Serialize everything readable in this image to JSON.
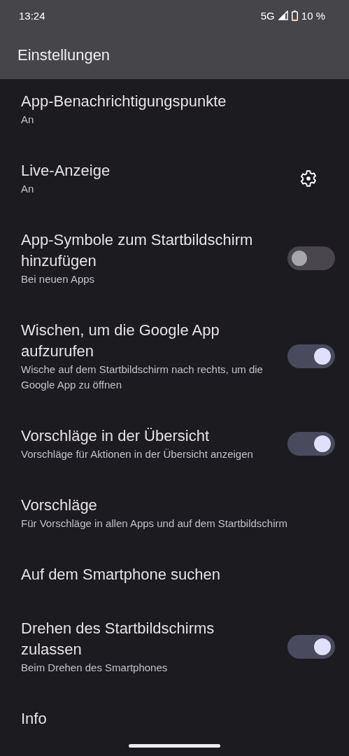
{
  "status_bar": {
    "time": "13:24",
    "network": "5G",
    "battery": "10 %"
  },
  "app_bar": {
    "title": "Einstellungen"
  },
  "settings": [
    {
      "kind": "plain",
      "title": "App-Benachrichtigungspunkte",
      "subtitle": "An"
    },
    {
      "kind": "gear",
      "title": "Live-Anzeige",
      "subtitle": "An"
    },
    {
      "kind": "toggle",
      "title": "App-Symbole zum Startbildschirm hinzufügen",
      "subtitle": "Bei neuen Apps",
      "on": false
    },
    {
      "kind": "toggle",
      "title": "Wischen, um die Google App aufzurufen",
      "subtitle": "Wische auf dem Startbildschirm nach rechts, um die Google App zu öffnen",
      "on": true
    },
    {
      "kind": "toggle",
      "title": "Vorschläge in der Übersicht",
      "subtitle": "Vorschläge für Aktionen in der Übersicht anzeigen",
      "on": true
    },
    {
      "kind": "plain",
      "title": "Vorschläge",
      "subtitle": "Für Vorschläge in allen Apps und auf dem Startbildschirm"
    },
    {
      "kind": "plain",
      "title": "Auf dem Smartphone suchen"
    },
    {
      "kind": "toggle",
      "title": "Drehen des Startbildschirms zulassen",
      "subtitle": "Beim Drehen des Smartphones",
      "on": true
    },
    {
      "kind": "plain",
      "title": "Info"
    }
  ]
}
